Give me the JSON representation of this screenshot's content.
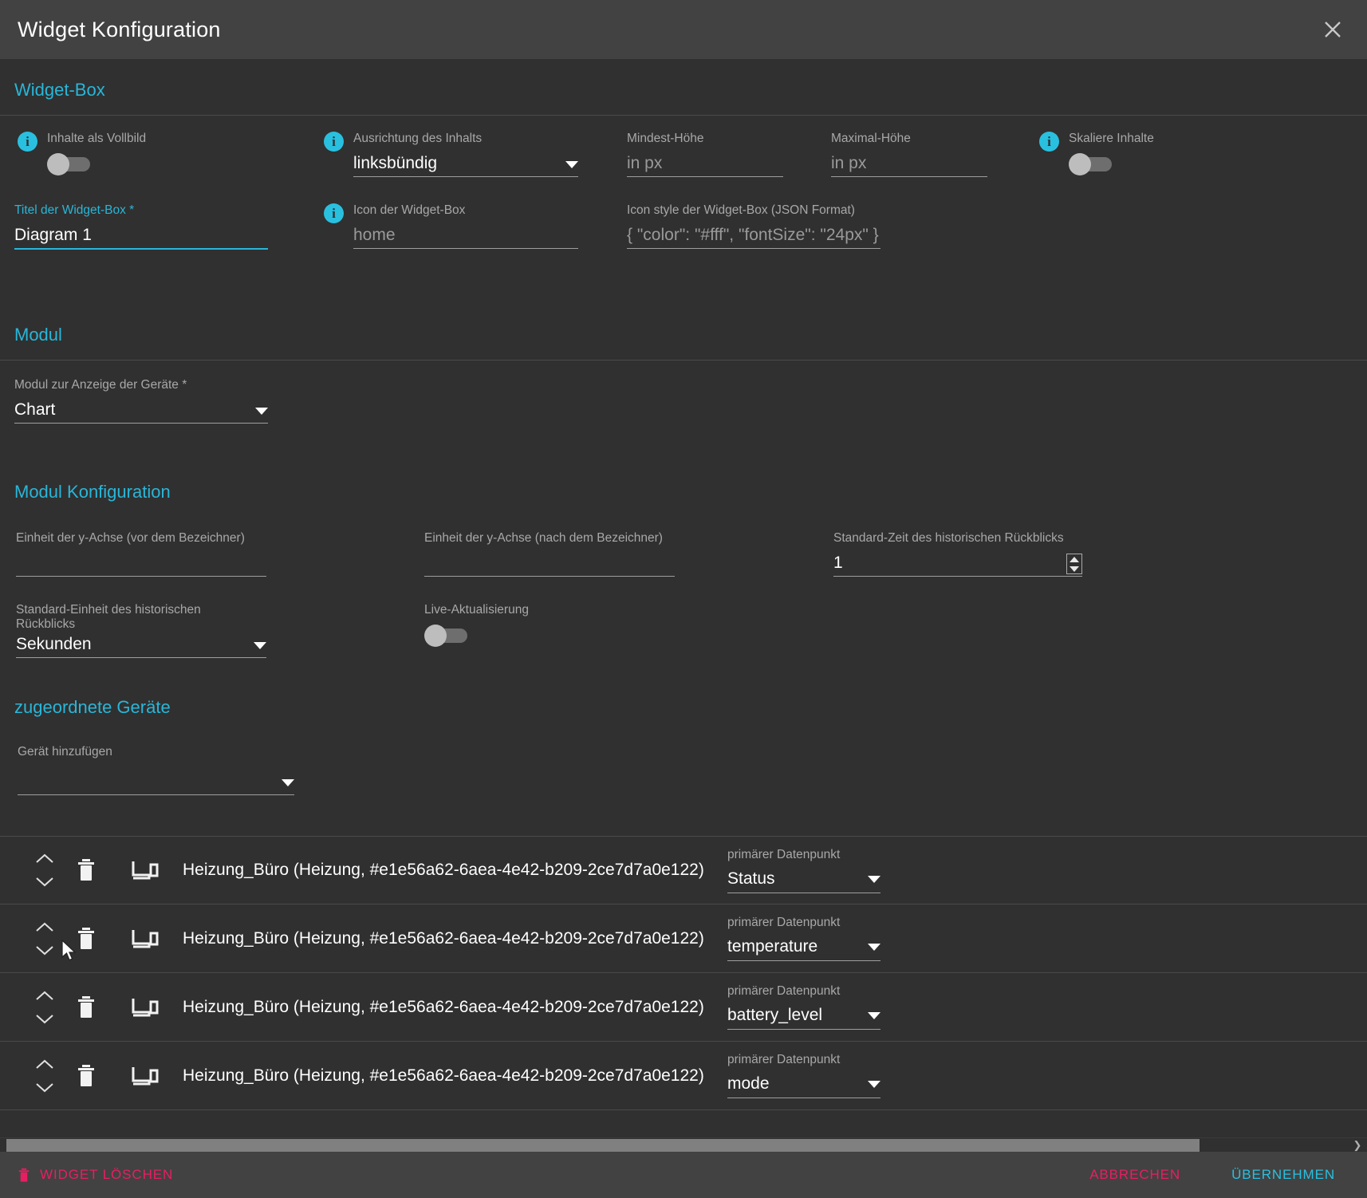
{
  "dialog": {
    "title": "Widget Konfiguration",
    "close_icon": "close-icon"
  },
  "sections": {
    "widget_box": "Widget-Box",
    "modul": "Modul",
    "modul_konfiguration": "Modul Konfiguration",
    "zugeordnete_geraete": "zugeordnete Geräte"
  },
  "widget_box": {
    "fullscreen": {
      "label": "Inhalte als Vollbild",
      "value": "off"
    },
    "alignment": {
      "label": "Ausrichtung des Inhalts",
      "value": "linksbündig"
    },
    "min_height": {
      "label": "Mindest-Höhe",
      "value": "",
      "placeholder": "in px"
    },
    "max_height": {
      "label": "Maximal-Höhe",
      "value": "",
      "placeholder": "in px"
    },
    "scale_content": {
      "label": "Skaliere Inhalte",
      "value": "off"
    },
    "title_field": {
      "label": "Titel der Widget-Box *",
      "value": "Diagram 1"
    },
    "icon_field": {
      "label": "Icon der Widget-Box",
      "value": "",
      "placeholder": "home"
    },
    "icon_style": {
      "label": "Icon style der Widget-Box (JSON Format)",
      "value": "",
      "placeholder": "{ \"color\": \"#fff\", \"fontSize\": \"24px\" }"
    }
  },
  "modul": {
    "device_module": {
      "label": "Modul zur Anzeige der Geräte *",
      "value": "Chart"
    }
  },
  "modul_konfiguration": {
    "y_unit_before": {
      "label": "Einheit der y-Achse (vor dem Bezeichner)",
      "value": ""
    },
    "y_unit_after": {
      "label": "Einheit der y-Achse (nach dem Bezeichner)",
      "value": ""
    },
    "default_history_time": {
      "label": "Standard-Zeit des historischen Rückblicks",
      "value": "1"
    },
    "default_history_unit": {
      "label": "Standard-Einheit des historischen Rückblicks",
      "value": "Sekunden"
    },
    "live_update": {
      "label": "Live-Aktualisierung",
      "value": "off"
    }
  },
  "devices": {
    "add_device": {
      "label": "Gerät hinzufügen",
      "value": ""
    },
    "datapoint_label": "primärer Datenpunkt",
    "rows": [
      {
        "name": "Heizung_Büro (Heizung, #e1e56a62-6aea-4e42-b209-2ce7d7a0e122)",
        "datapoint": "Status"
      },
      {
        "name": "Heizung_Büro (Heizung, #e1e56a62-6aea-4e42-b209-2ce7d7a0e122)",
        "datapoint": "temperature"
      },
      {
        "name": "Heizung_Büro (Heizung, #e1e56a62-6aea-4e42-b209-2ce7d7a0e122)",
        "datapoint": "battery_level"
      },
      {
        "name": "Heizung_Büro (Heizung, #e1e56a62-6aea-4e42-b209-2ce7d7a0e122)",
        "datapoint": "mode"
      }
    ]
  },
  "footer": {
    "delete_label": "WIDGET LÖSCHEN",
    "cancel_label": "ABBRECHEN",
    "apply_label": "ÜBERNEHMEN"
  },
  "colors": {
    "accent": "#29c0e0",
    "danger": "#e81e63",
    "bg": "#303030",
    "bar": "#424242"
  }
}
